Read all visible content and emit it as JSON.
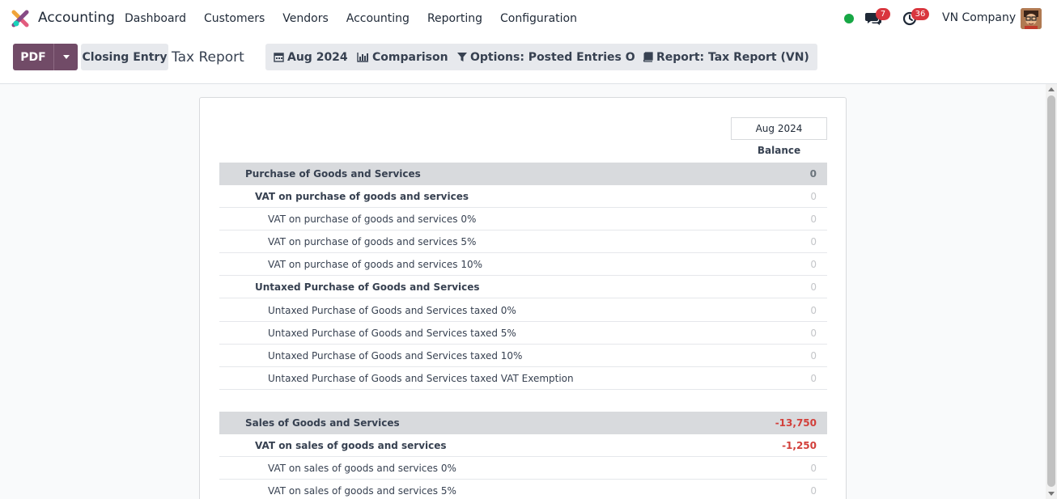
{
  "navbar": {
    "app_name": "Accounting",
    "menu": [
      "Dashboard",
      "Customers",
      "Vendors",
      "Accounting",
      "Reporting",
      "Configuration"
    ],
    "chat_count": "7",
    "activity_count": "36",
    "company": "VN Company"
  },
  "control": {
    "pdf_label": "PDF",
    "closing_label": "Closing Entry",
    "title": "Tax Report",
    "filters": {
      "date": "Aug 2024",
      "comparison": "Comparison",
      "options": "Options: Posted Entries Only",
      "report": "Report: Tax Report (VN)"
    }
  },
  "report": {
    "period": "Aug 2024",
    "column": "Balance",
    "rows": [
      {
        "label": "Purchase of Goods and Services",
        "value": "0",
        "level": 0
      },
      {
        "label": "VAT on purchase of goods and services",
        "value": "0",
        "level": 1
      },
      {
        "label": "VAT on purchase of goods and services 0%",
        "value": "0",
        "level": 2
      },
      {
        "label": "VAT on purchase of goods and services 5%",
        "value": "0",
        "level": 2
      },
      {
        "label": "VAT on purchase of goods and services 10%",
        "value": "0",
        "level": 2
      },
      {
        "label": "Untaxed Purchase of Goods and Services",
        "value": "0",
        "level": 1
      },
      {
        "label": "Untaxed Purchase of Goods and Services taxed 0%",
        "value": "0",
        "level": 2
      },
      {
        "label": "Untaxed Purchase of Goods and Services taxed 5%",
        "value": "0",
        "level": 2
      },
      {
        "label": "Untaxed Purchase of Goods and Services taxed 10%",
        "value": "0",
        "level": 2
      },
      {
        "label": "Untaxed Purchase of Goods and Services taxed VAT Exemption",
        "value": "0",
        "level": 2
      },
      {
        "label": "Sales of Goods and Services",
        "value": "-13,750",
        "level": 0
      },
      {
        "label": "VAT on sales of goods and services",
        "value": "-1,250",
        "level": 1
      },
      {
        "label": "VAT on sales of goods and services 0%",
        "value": "0",
        "level": 2
      },
      {
        "label": "VAT on sales of goods and services 5%",
        "value": "0",
        "level": 2
      }
    ]
  },
  "colors": {
    "brand": "#714b67",
    "negative": "#d23f3a",
    "online": "#17a745",
    "badge": "#d9363e"
  }
}
